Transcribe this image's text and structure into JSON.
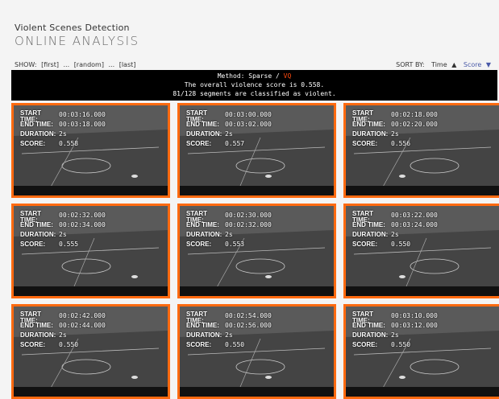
{
  "header": {
    "title": "Violent Scenes Detection",
    "subtitle": "ONLINE ANALYSIS"
  },
  "controls": {
    "show_label": "SHOW:",
    "show_links": [
      "[first]",
      "...",
      "[random]",
      "...",
      "[last]"
    ],
    "sort_label": "SORT BY:",
    "sort_time": "Time",
    "sort_score": "Score"
  },
  "summary": {
    "method_prefix": "Method: Sparse /",
    "method_vq": "VQ",
    "line2": "The overall violence score is 0.558.",
    "line3": "81/128 segments are classified as violent."
  },
  "labels": {
    "start": "START TIME:",
    "end": "END TIME:",
    "duration": "DURATION:",
    "score": "SCORE:"
  },
  "segments": [
    {
      "start": "00:03:16.000",
      "end": "00:03:18.000",
      "duration": "2s",
      "score": "0.558"
    },
    {
      "start": "00:03:00.000",
      "end": "00:03:02.000",
      "duration": "2s",
      "score": "0.557"
    },
    {
      "start": "00:02:18.000",
      "end": "00:02:20.000",
      "duration": "2s",
      "score": "0.556"
    },
    {
      "start": "00:02:32.000",
      "end": "00:02:34.000",
      "duration": "2s",
      "score": "0.555"
    },
    {
      "start": "00:02:30.000",
      "end": "00:02:32.000",
      "duration": "2s",
      "score": "0.553"
    },
    {
      "start": "00:03:22.000",
      "end": "00:03:24.000",
      "duration": "2s",
      "score": "0.550"
    },
    {
      "start": "00:02:42.000",
      "end": "00:02:44.000",
      "duration": "2s",
      "score": "0.550"
    },
    {
      "start": "00:02:54.000",
      "end": "00:02:56.000",
      "duration": "2s",
      "score": "0.550"
    },
    {
      "start": "00:03:10.000",
      "end": "00:03:12.000",
      "duration": "2s",
      "score": "0.550"
    }
  ],
  "colors": {
    "accent": "#ff6a10",
    "sort_link": "#4a5aa8"
  }
}
